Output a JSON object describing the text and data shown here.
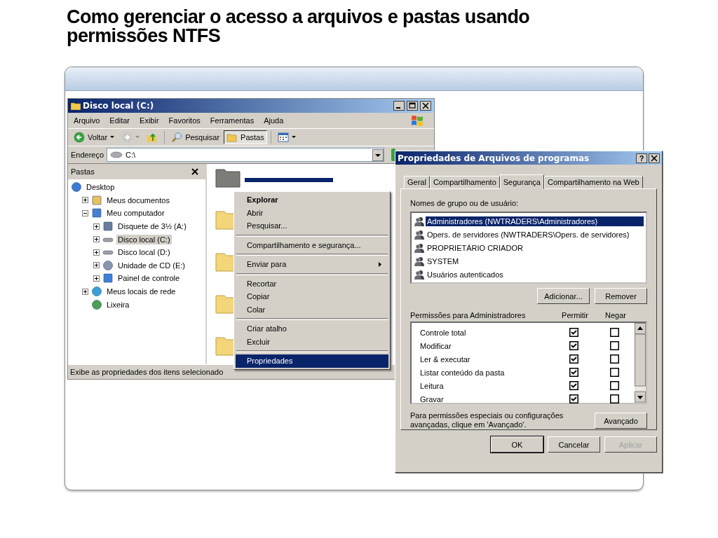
{
  "slide_title": "Como gerenciar o acesso a arquivos e pastas usando permissões NTFS",
  "explorer": {
    "title": "Disco local (C:)",
    "menu": [
      "Arquivo",
      "Editar",
      "Exibir",
      "Favoritos",
      "Ferramentas",
      "Ajuda"
    ],
    "toolbar": [
      {
        "kind": "back",
        "label": "Voltar",
        "pressed": false
      },
      {
        "kind": "forward",
        "pressed": false
      },
      {
        "kind": "up",
        "pressed": false
      },
      {
        "kind": "search",
        "label": "Pesquisar",
        "pressed": false
      },
      {
        "kind": "folders",
        "label": "Pastas",
        "pressed": true
      },
      {
        "kind": "views",
        "pressed": false
      }
    ],
    "address": {
      "label": "Endereço",
      "value": "C:\\"
    },
    "folders_pane": {
      "title": "Pastas",
      "tree": [
        {
          "label": "Desktop",
          "kind": "desktop",
          "selected": false,
          "children": [
            {
              "label": "Meus documentos",
              "kind": "documents",
              "expanded": false,
              "selected": false
            },
            {
              "label": "Meu computador",
              "kind": "computer",
              "expanded": true,
              "selected": false,
              "children": [
                {
                  "label": "Disquete de 3½ (A:)",
                  "kind": "floppy",
                  "expanded": false,
                  "selected": false
                },
                {
                  "label": "Disco local (C:)",
                  "kind": "drive",
                  "expanded": false,
                  "selected": true
                },
                {
                  "label": "Disco local (D:)",
                  "kind": "drive",
                  "expanded": false,
                  "selected": false
                },
                {
                  "label": "Unidade de CD (E:)",
                  "kind": "cd",
                  "expanded": false,
                  "selected": false
                },
                {
                  "label": "Painel de controle",
                  "kind": "control-panel",
                  "expanded": false,
                  "selected": false
                }
              ]
            },
            {
              "label": "Meus locais de rede",
              "kind": "network",
              "expanded": false,
              "selected": false
            },
            {
              "label": "Lixeira",
              "kind": "recycle",
              "selected": false
            }
          ]
        }
      ]
    },
    "folders": [
      {
        "selected": true
      },
      {
        "selected": false
      },
      {
        "selected": false
      },
      {
        "selected": false
      },
      {
        "selected": false
      }
    ],
    "status": "Exibe as propriedades dos itens selecionado"
  },
  "context_menu": [
    {
      "kind": "item",
      "label": "Explorar",
      "default": true,
      "submenu": false,
      "selected": false
    },
    {
      "kind": "item",
      "label": "Abrir",
      "default": false,
      "submenu": false,
      "selected": false
    },
    {
      "kind": "item",
      "label": "Pesquisar...",
      "default": false,
      "submenu": false,
      "selected": false
    },
    {
      "kind": "separator"
    },
    {
      "kind": "item",
      "label": "Compartilhamento e segurança...",
      "default": false,
      "submenu": false,
      "selected": false
    },
    {
      "kind": "separator"
    },
    {
      "kind": "item",
      "label": "Enviar para",
      "default": false,
      "submenu": true,
      "selected": false
    },
    {
      "kind": "separator"
    },
    {
      "kind": "item",
      "label": "Recortar",
      "default": false,
      "submenu": false,
      "selected": false
    },
    {
      "kind": "item",
      "label": "Copiar",
      "default": false,
      "submenu": false,
      "selected": false
    },
    {
      "kind": "item",
      "label": "Colar",
      "default": false,
      "submenu": false,
      "selected": false
    },
    {
      "kind": "separator"
    },
    {
      "kind": "item",
      "label": "Criar atalho",
      "default": false,
      "submenu": false,
      "selected": false
    },
    {
      "kind": "item",
      "label": "Excluir",
      "default": false,
      "submenu": false,
      "selected": false
    },
    {
      "kind": "separator"
    },
    {
      "kind": "item",
      "label": "Propriedades",
      "default": false,
      "submenu": false,
      "selected": true
    }
  ],
  "dialog": {
    "title": "Propriedades de Arquivos de programas",
    "help": "?",
    "tabs": [
      {
        "label": "Geral",
        "selected": false
      },
      {
        "label": "Compartilhamento",
        "selected": false
      },
      {
        "label": "Segurança",
        "selected": true
      },
      {
        "label": "Compartilhamento na Web",
        "selected": false
      }
    ],
    "users_label": "Nomes de grupo ou de usuário:",
    "users": [
      {
        "name": "Administradores (NWTRADERS\\Administradores)",
        "selected": true
      },
      {
        "name": "Opers. de servidores (NWTRADERS\\Opers. de servidores)",
        "selected": false
      },
      {
        "name": "PROPRIETÁRIO CRIADOR",
        "selected": false
      },
      {
        "name": "SYSTEM",
        "selected": false
      },
      {
        "name": "Usuários autenticados",
        "selected": false
      }
    ],
    "user_buttons": [
      "Adicionar...",
      "Remover"
    ],
    "permissions_label": "Permissões para Administradores",
    "allow_header": "Permitir",
    "deny_header": "Negar",
    "permissions": [
      {
        "name": "Controle total",
        "allow": true,
        "deny": false
      },
      {
        "name": "Modificar",
        "allow": true,
        "deny": false
      },
      {
        "name": "Ler & executar",
        "allow": true,
        "deny": false
      },
      {
        "name": "Listar conteúdo da pasta",
        "allow": true,
        "deny": false
      },
      {
        "name": "Leitura",
        "allow": true,
        "deny": false
      },
      {
        "name": "Gravar",
        "allow": true,
        "deny": false
      }
    ],
    "advanced_note": "Para permissões especiais ou configurações avançadas, clique em 'Avançado'.",
    "advanced_button": "Avançado",
    "buttons": [
      {
        "label": "OK",
        "disabled": false,
        "default": true
      },
      {
        "label": "Cancelar",
        "disabled": false,
        "default": false
      },
      {
        "label": "Aplicar",
        "disabled": true,
        "default": false
      }
    ]
  }
}
